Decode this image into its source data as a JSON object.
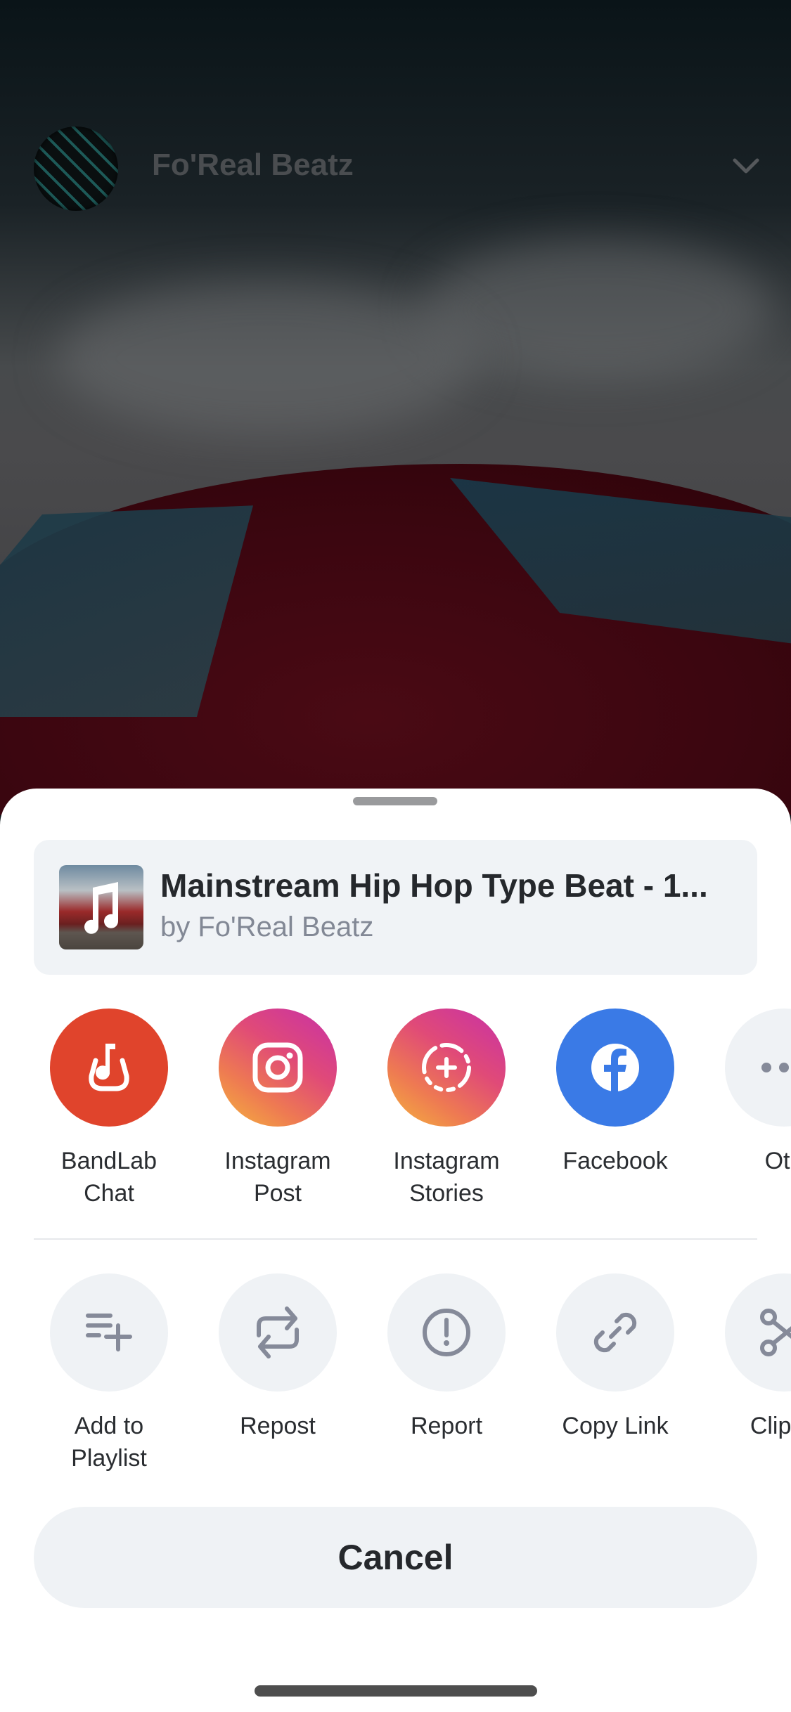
{
  "background": {
    "artist_name": "Fo'Real Beatz"
  },
  "share_sheet": {
    "track": {
      "title": "Mainstream Hip Hop Type Beat - 1...",
      "subtitle": "by Fo'Real Beatz"
    },
    "share_targets": [
      {
        "label_line1": "BandLab",
        "label_line2": "Chat",
        "icon": "bandlab-icon",
        "color": "#e0442c"
      },
      {
        "label_line1": "Instagram",
        "label_line2": "Post",
        "icon": "instagram-icon",
        "color": "#e04a78"
      },
      {
        "label_line1": "Instagram",
        "label_line2": "Stories",
        "icon": "instagram-stories-icon",
        "color": "#e04a78"
      },
      {
        "label_line1": "Facebook",
        "label_line2": "",
        "icon": "facebook-icon",
        "color": "#3a7ae6"
      },
      {
        "label_line1": "Oth",
        "label_line2": "",
        "icon": "more-icon",
        "color": "#eff2f5"
      }
    ],
    "actions": [
      {
        "label_line1": "Add to",
        "label_line2": "Playlist",
        "icon": "add-to-playlist-icon"
      },
      {
        "label_line1": "Repost",
        "label_line2": "",
        "icon": "repost-icon"
      },
      {
        "label_line1": "Report",
        "label_line2": "",
        "icon": "report-icon"
      },
      {
        "label_line1": "Copy Link",
        "label_line2": "",
        "icon": "link-icon"
      },
      {
        "label_line1": "Clip M",
        "label_line2": "",
        "icon": "scissors-icon"
      }
    ],
    "cancel_label": "Cancel"
  }
}
